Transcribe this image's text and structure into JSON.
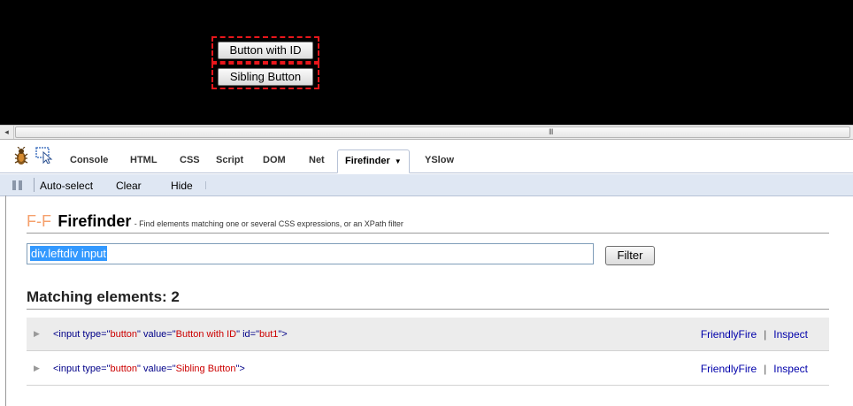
{
  "page": {
    "buttons": [
      "Button with ID",
      "Sibling Button"
    ]
  },
  "scrollbar": {
    "left_arrow": "◂",
    "grip": "III"
  },
  "tabs": [
    {
      "label": "Console",
      "active": false
    },
    {
      "label": "HTML",
      "active": false
    },
    {
      "label": "CSS",
      "active": false
    },
    {
      "label": "Script",
      "active": false
    },
    {
      "label": "DOM",
      "active": false
    },
    {
      "label": "Net",
      "active": false
    },
    {
      "label": "Firefinder",
      "active": true,
      "caret": "▼"
    },
    {
      "label": "YSlow",
      "active": false
    }
  ],
  "subtoolbar": {
    "items": [
      "Auto-select",
      "Clear",
      "Hide"
    ]
  },
  "firefinder": {
    "logo": "F-F",
    "title": "Firefinder",
    "description": "- Find elements matching one or several CSS expressions, or an XPath filter",
    "filter_value": "div.leftdiv input",
    "filter_button": "Filter",
    "matching_title": "Matching elements: 2",
    "results": [
      {
        "open": "<input type=\"",
        "type_val": "button",
        "mid": "\" value=\"",
        "value_val": "Button with ID",
        "mid2": "\" id=\"",
        "id_val": "but1",
        "close": "\">"
      },
      {
        "open": "<input type=\"",
        "type_val": "button",
        "mid": "\" value=\"",
        "value_val": "Sibling Button",
        "close": "\">"
      }
    ],
    "link_friendlyfire": "FriendlyFire",
    "link_separator": "|",
    "link_inspect": "Inspect",
    "row_toggle": "▶"
  },
  "colors": {
    "highlight_border": "#e8161b",
    "toolbar_bg": "#dfe7f3",
    "logo": "#f5a06c",
    "selection": "#3399ff",
    "attr_value": "#cc0000",
    "tag": "#000088"
  }
}
